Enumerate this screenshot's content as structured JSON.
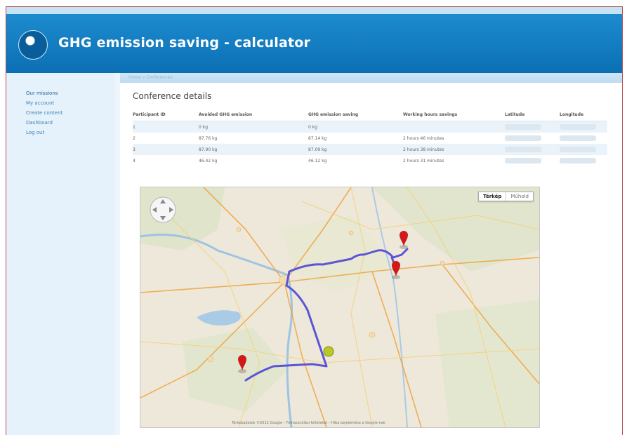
{
  "header": {
    "title": "GHG emission saving - calculator"
  },
  "sidebar": {
    "items": [
      {
        "label": "Our missions"
      },
      {
        "label": "My account"
      },
      {
        "label": "Create content"
      },
      {
        "label": "Dashboard"
      },
      {
        "label": "Log out"
      }
    ]
  },
  "breadcrumb": "Home » Conferences",
  "main": {
    "section_title": "Conference details",
    "table": {
      "headers": [
        "Participant ID",
        "Avoided GHG emission",
        "GHG emission saving",
        "Working hours savings",
        "Latitude",
        "Longitude"
      ],
      "rows": [
        [
          "1",
          "0 kg",
          "0 kg",
          "",
          "",
          ""
        ],
        [
          "2",
          "87.76 kg",
          "87.14 kg",
          "2 hours 46 minutes",
          "",
          ""
        ],
        [
          "3",
          "87.90 kg",
          "87.09 kg",
          "2 hours 38 minutes",
          "",
          ""
        ],
        [
          "4",
          "46.42 kg",
          "46.12 kg",
          "2 hours 31 minutes",
          "",
          ""
        ]
      ]
    }
  },
  "map": {
    "toggle_map": "Térkép",
    "toggle_sat": "Műhold",
    "copyright": "Térképadatok ©2012 Google – Felhasználási feltételek – Hiba bejelentése a Google-nak",
    "route_color": "#5b55d6",
    "marker_color": "#d01a1a",
    "center_marker_color": "#b8c825"
  }
}
